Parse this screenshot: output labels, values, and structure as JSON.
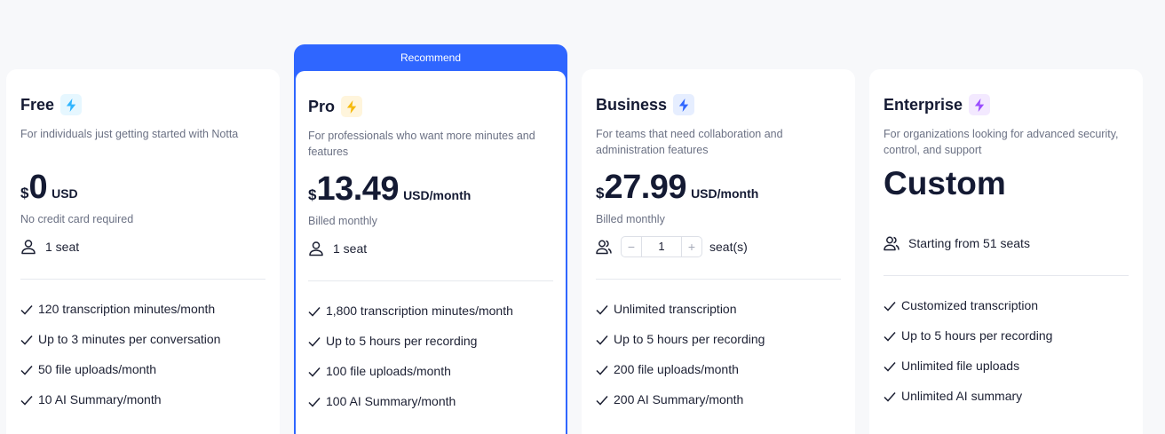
{
  "plans": [
    {
      "title": "Free",
      "description": "For individuals just getting started with Notta",
      "currency": "$",
      "amount": "0",
      "unit": "USD",
      "note": "No credit card required",
      "seats": "1 seat",
      "bolt_color": "#2fb5ff",
      "bolt_bg": "#e6f7ff",
      "features": [
        "120 transcription minutes/month",
        "Up to 3 minutes per conversation",
        "50 file uploads/month",
        "10 AI Summary/month"
      ]
    },
    {
      "ribbon": "Recommend",
      "title": "Pro",
      "description": "For professionals who want more minutes and features",
      "currency": "$",
      "amount": "13.49",
      "unit": "USD/month",
      "note": "Billed monthly",
      "seats": "1 seat",
      "bolt_color": "#f5b90a",
      "bolt_bg": "#fff5dc",
      "features": [
        "1,800 transcription minutes/month",
        "Up to 5 hours per recording",
        "100 file uploads/month",
        "100 AI Summary/month"
      ]
    },
    {
      "title": "Business",
      "description": "For teams that need collaboration and administration features",
      "currency": "$",
      "amount": "27.99",
      "unit": "USD/month",
      "note": "Billed monthly",
      "stepper": {
        "minus": "−",
        "value": "1",
        "plus": "+",
        "suffix": "seat(s)"
      },
      "bolt_color": "#2f66ff",
      "bolt_bg": "#e6eeff",
      "features": [
        "Unlimited transcription",
        "Up to 5 hours per recording",
        "200 file uploads/month",
        "200 AI Summary/month"
      ]
    },
    {
      "title": "Enterprise",
      "description": "For organizations looking for advanced security, control, and support",
      "price_text": "Custom",
      "seats": "Starting from 51 seats",
      "bolt_color": "#9b4dff",
      "bolt_bg": "#f3e9ff",
      "features": [
        "Customized transcription",
        "Up to 5 hours per recording",
        "Unlimited file uploads",
        "Unlimited AI summary"
      ]
    }
  ],
  "accent": "#2f66ff"
}
